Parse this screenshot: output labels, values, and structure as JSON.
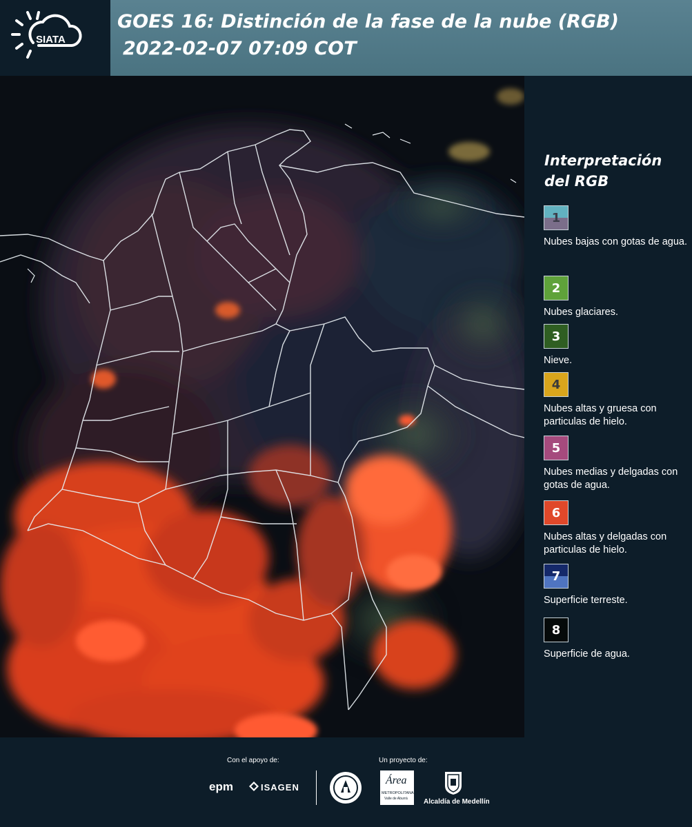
{
  "header": {
    "logo_text": "SIATA",
    "title_line1": "GOES 16: Distinción de la fase de la nube (RGB)",
    "title_line2": "2022-02-07 07:09 COT"
  },
  "legend": {
    "title_line1": "Interpretación",
    "title_line2": "del RGB",
    "items": [
      {
        "number": "1",
        "label": "Nubes bajas con gotas de agua.",
        "color_top": "#62b2c0",
        "color_bottom": "#7b6e8a",
        "text_color": "#3d3d4a"
      },
      {
        "number": "2",
        "label": "Nubes glaciares.",
        "color_top": "#5fa23a",
        "color_bottom": "#5fa23a",
        "text_color": "#ffffff"
      },
      {
        "number": "3",
        "label": "Nieve.",
        "color_top": "#2f5e22",
        "color_bottom": "#2f5e22",
        "text_color": "#ffffff"
      },
      {
        "number": "4",
        "label": "Nubes altas y gruesa con particulas de hielo.",
        "color_top": "#d9a51c",
        "color_bottom": "#d9a51c",
        "text_color": "#3a3a3a"
      },
      {
        "number": "5",
        "label": "Nubes medias y delgadas con gotas de agua.",
        "color_top": "#a54a7d",
        "color_bottom": "#a54a7d",
        "text_color": "#ffffff"
      },
      {
        "number": "6",
        "label": "Nubes altas y delgadas con particulas de hielo.",
        "color_top": "#e0482a",
        "color_bottom": "#e0482a",
        "text_color": "#ffffff"
      },
      {
        "number": "7",
        "label": "Superficie terreste.",
        "color_top": "#15296a",
        "color_bottom": "#4f74c0",
        "text_color": "#ffffff"
      },
      {
        "number": "8",
        "label": "Superficie de agua.",
        "color_top": "#050a0a",
        "color_bottom": "#050a0a",
        "text_color": "#ffffff"
      }
    ]
  },
  "footer": {
    "support_caption": "Con el apoyo de:",
    "project_caption": "Un proyecto de:",
    "epm": "epm",
    "isagen": "ISAGEN",
    "area_metro": "Área",
    "area_metro_sub": "METROPOLITANA",
    "area_metro_sub2": "Valle de Aburrá",
    "alcaldia": "Alcaldía de Medellín"
  },
  "colors": {
    "background": "#0d1d29",
    "header_band": "#5a8291",
    "cloud_red": "#e2421f",
    "land_dark": "#3a2530"
  }
}
